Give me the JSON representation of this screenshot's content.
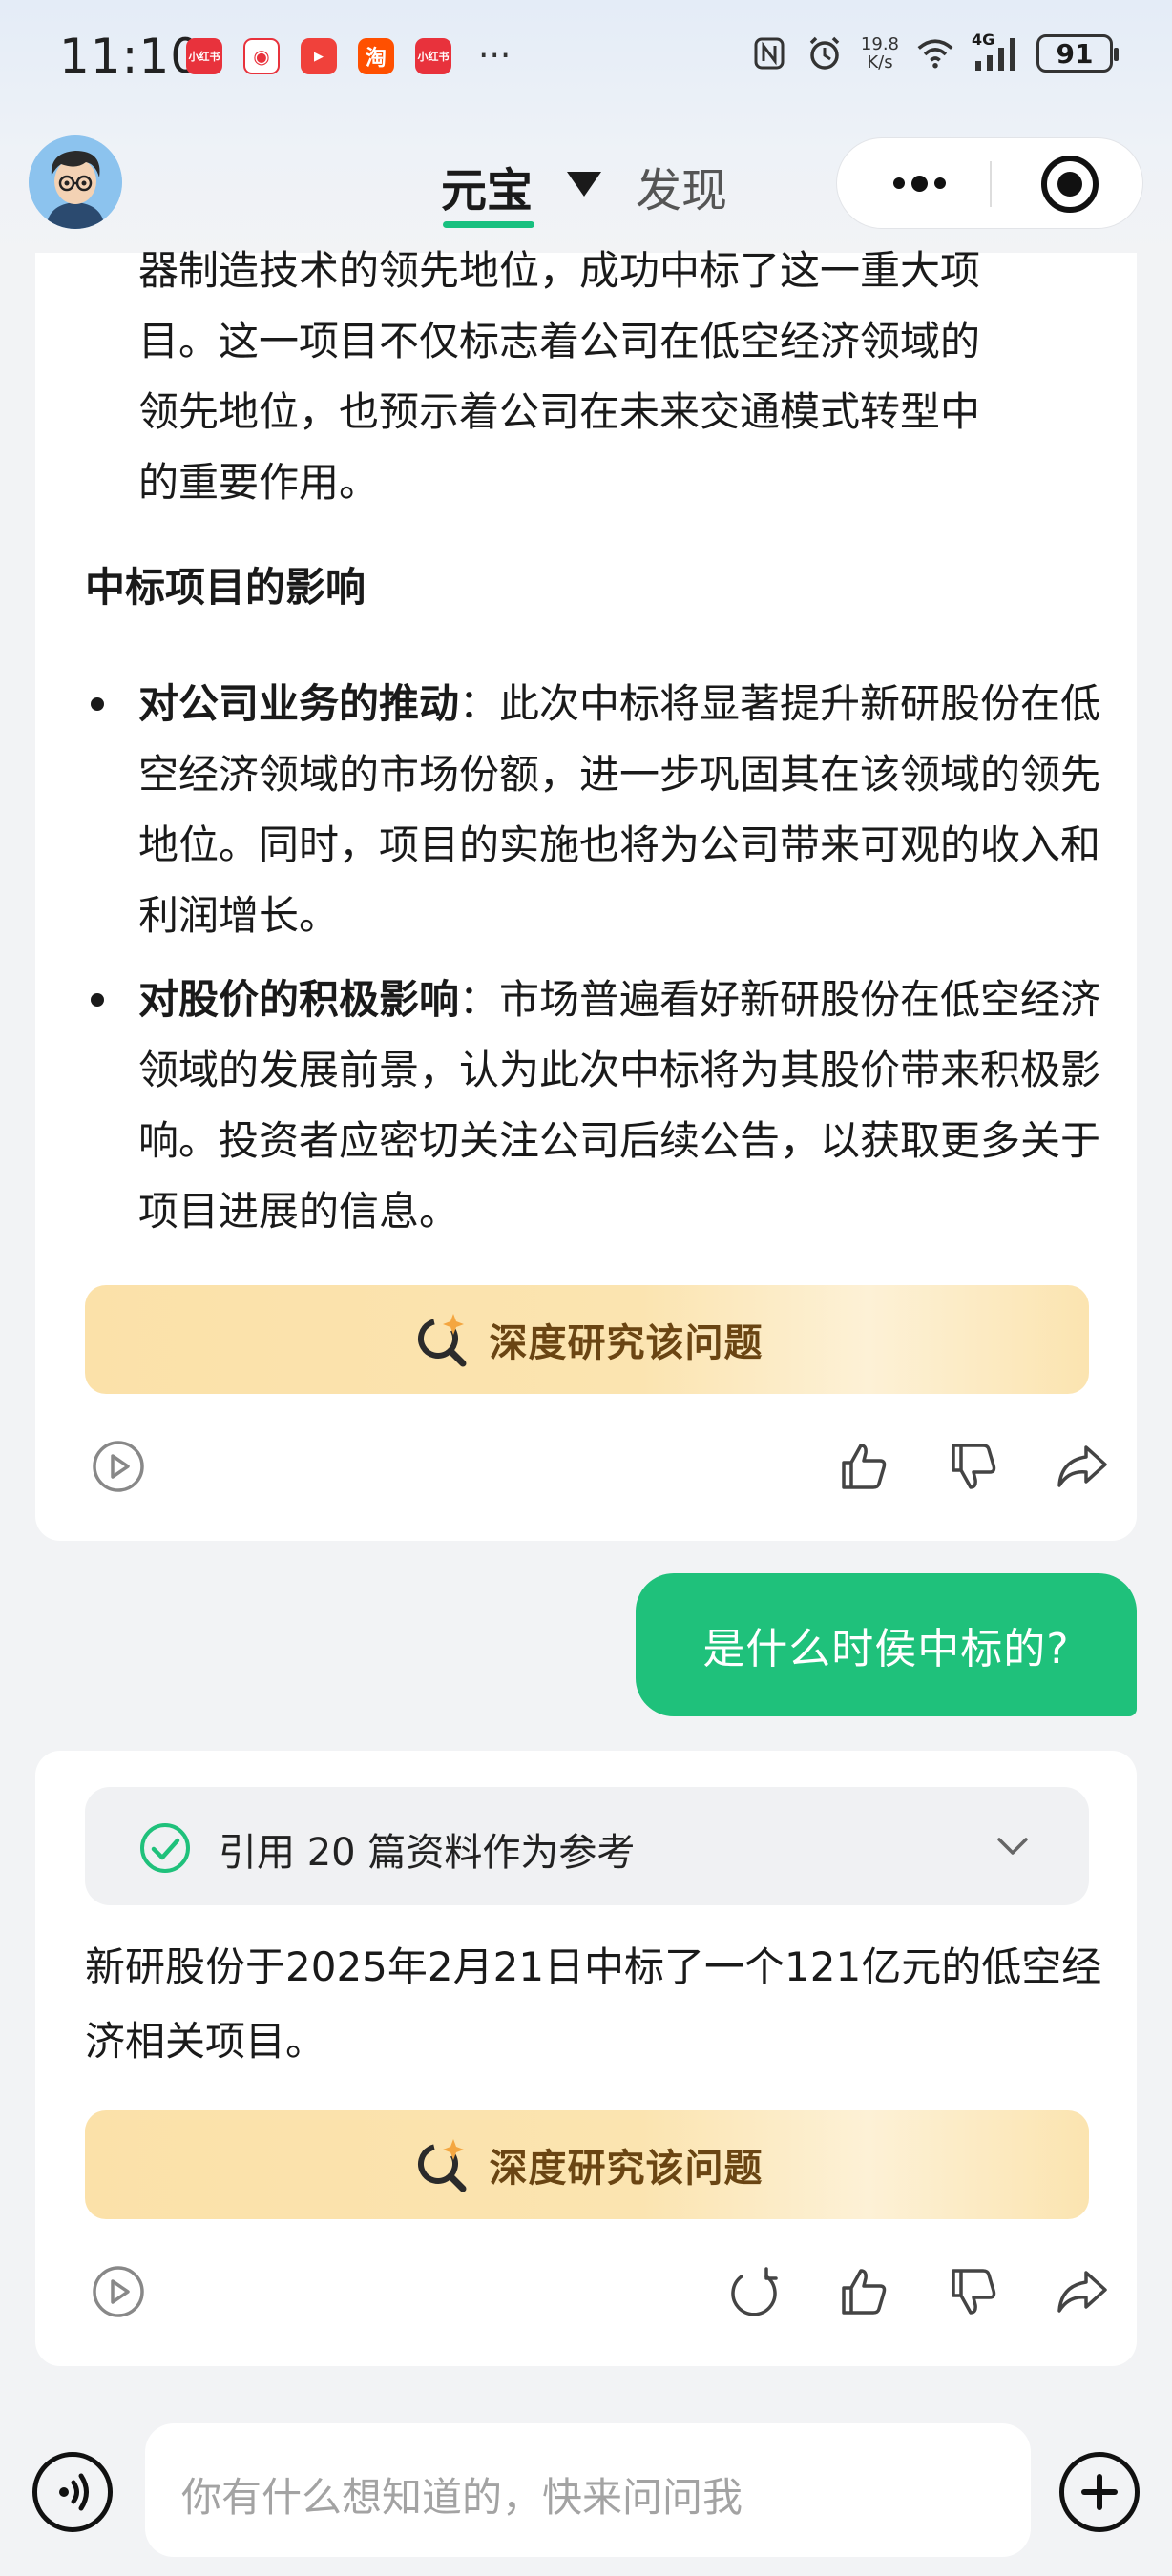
{
  "status_bar": {
    "time": "11:10",
    "notif_apps": [
      "小红书",
      "微博",
      "视频",
      "淘",
      "小红书"
    ],
    "net_speed_value": "19.8",
    "net_speed_unit": "K/s",
    "signal_label": "4G",
    "battery": "91"
  },
  "header": {
    "tab_active": "元宝",
    "tab_other": "发现"
  },
  "message1": {
    "para_lines": [
      "器制造技术的领先地位，成功中标了这一重大项",
      "目。这一项目不仅标志着公司在低空经济领域的",
      "领先地位，也预示着公司在未来交通模式转型中",
      "的重要作用。"
    ],
    "heading": "中标项目的影响",
    "bullets": [
      {
        "title": "对公司业务的推动",
        "text": "：此次中标将显著提升新研股份在低空经济领域的市场份额，进一步巩固其在该领域的领先地位。同时，项目的实施也将为公司带来可观的收入和利润增长。"
      },
      {
        "title": "对股价的积极影响",
        "text": "：市场普遍看好新研股份在低空经济领域的发展前景，认为此次中标将为其股价带来积极影响。投资者应密切关注公司后续公告，以获取更多关于项目进展的信息。"
      }
    ],
    "deep_research_label": "深度研究该问题"
  },
  "user_message": "是什么时侯中标的?",
  "message2": {
    "reference_label": "引用 20 篇资料作为参考",
    "answer": "新研股份于2025年2月21日中标了一个121亿元的低空经济相关项目。",
    "deep_research_label": "深度研究该问题"
  },
  "input": {
    "placeholder": "你有什么想知道的，快来问问我"
  },
  "colors": {
    "accent_green": "#1fc17b",
    "deep_research_text": "#6a4513",
    "deep_research_bg": "#fbe1a9"
  },
  "icons": [
    "play-icon",
    "thumb-up-icon",
    "thumb-down-icon",
    "share-icon",
    "regenerate-icon",
    "check-circle-icon",
    "chevron-down-icon",
    "voice-icon",
    "plus-icon",
    "more-icon",
    "target-icon"
  ]
}
